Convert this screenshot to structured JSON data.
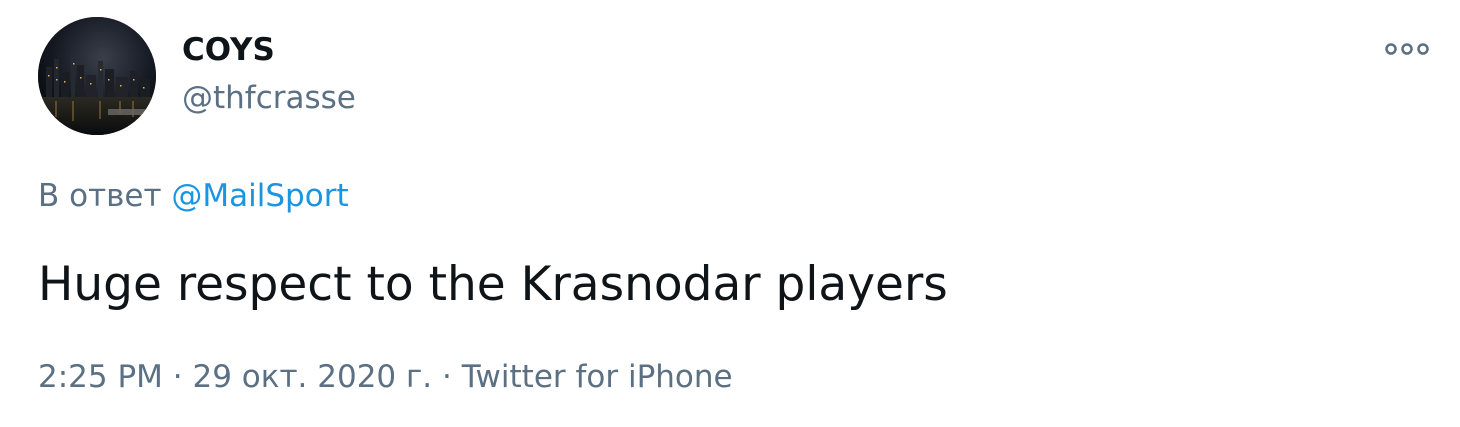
{
  "author": {
    "display_name": "COYS",
    "handle": "@thfcrasse",
    "avatar": "night-city-skyline-avatar"
  },
  "more_icon": "more-horizontal-icon",
  "reply": {
    "prefix": "В ответ",
    "mention": "@MailSport"
  },
  "tweet": {
    "text": "Huge respect to the Krasnodar players"
  },
  "meta": {
    "time": "2:25 PM",
    "separator": "·",
    "date": "29 окт. 2020 г.",
    "source": "Twitter for iPhone"
  },
  "colors": {
    "text_primary": "#0f1419",
    "text_secondary": "#5b7083",
    "link": "#1b95e0"
  }
}
